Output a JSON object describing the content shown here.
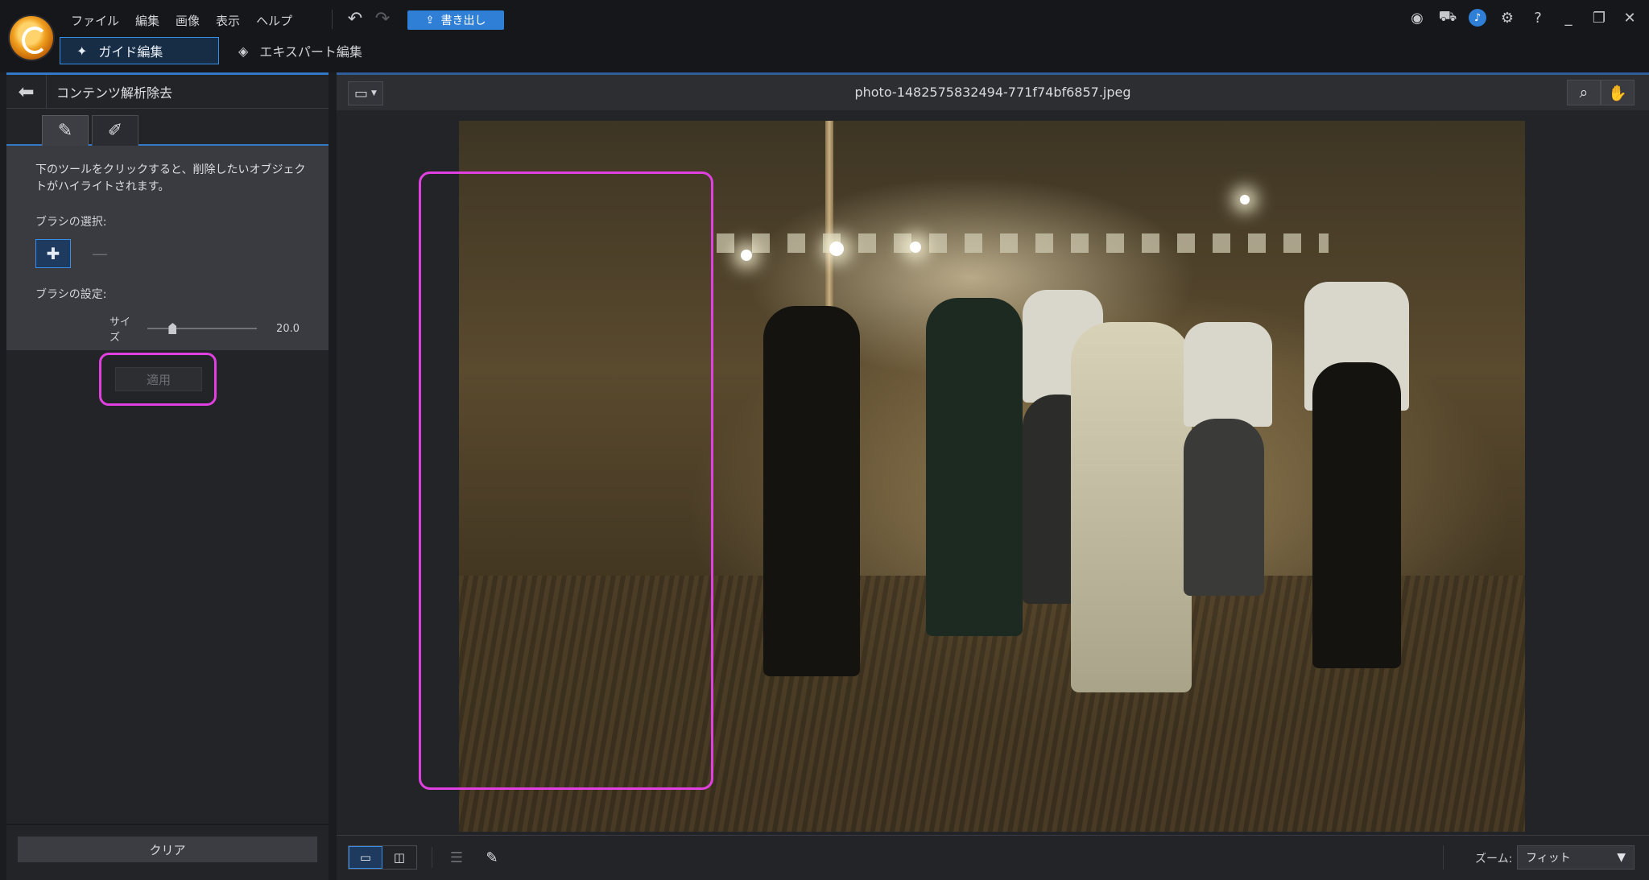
{
  "menu": [
    "ファイル",
    "編集",
    "画像",
    "表示",
    "ヘルプ"
  ],
  "toolbar": {
    "export_label": "書き出し"
  },
  "modes": {
    "guide": "ガイド編集",
    "expert": "エキスパート編集"
  },
  "panel": {
    "title": "コンテンツ解析除去",
    "description": "下のツールをクリックすると、削除したいオブジェクトがハイライトされます。",
    "brush_select_label": "ブラシの選択:",
    "brush_settings_label": "ブラシの設定:",
    "size_label": "サイズ",
    "size_value": "20.0",
    "size_fraction": 0.2,
    "apply_label": "適用",
    "clear_label": "クリア"
  },
  "viewer": {
    "filename": "photo-1482575832494-771f74bf6857.jpeg",
    "zoom_label": "ズーム:",
    "zoom_value": "フィット"
  },
  "colors": {
    "accent": "#2f7fd6",
    "highlight": "#e040e0"
  },
  "icons": {
    "logo": "app-logo-icon",
    "undo": "undo-icon",
    "redo": "redo-icon",
    "account": "account-icon",
    "cart": "cart-icon",
    "notifications": "bell-icon",
    "settings": "gear-icon",
    "help": "help-icon"
  }
}
